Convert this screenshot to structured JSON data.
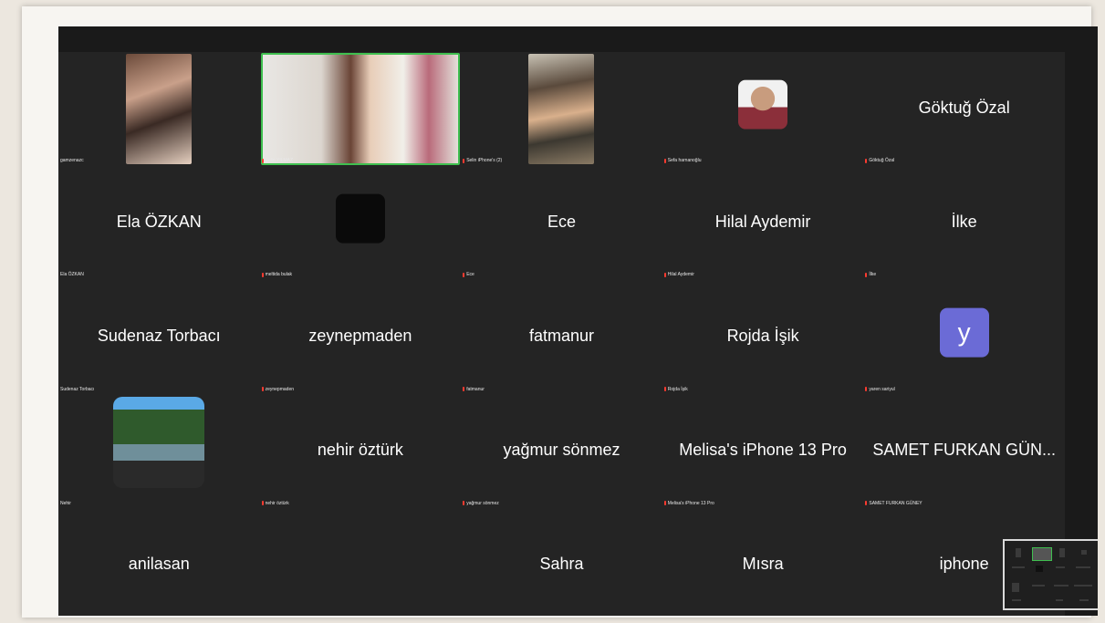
{
  "gallery": {
    "tiles": [
      {
        "name": "",
        "label": "gamzenazc",
        "kind": "video"
      },
      {
        "name": "",
        "label": "Selin YILMAZ",
        "kind": "video-active"
      },
      {
        "name": "",
        "label": "Selin iPhone's (2)",
        "kind": "video"
      },
      {
        "name": "",
        "label": "Sefa harnanoğlu",
        "kind": "avatar-photo"
      },
      {
        "name": "Göktuğ Özal",
        "label": "Göktuğ Özal",
        "kind": "name"
      },
      {
        "name": "Ela ÖZKAN",
        "label": "Ela ÖZKAN",
        "kind": "name"
      },
      {
        "name": "",
        "label": "meltida bulak",
        "kind": "avatar-dark"
      },
      {
        "name": "Ece",
        "label": "Ece",
        "kind": "name"
      },
      {
        "name": "Hilal Aydemir",
        "label": "Hilal Aydemir",
        "kind": "name"
      },
      {
        "name": "İlke",
        "label": "İlke",
        "kind": "name"
      },
      {
        "name": "Sudenaz Torbacı",
        "label": "Sudenaz Torbacı",
        "kind": "name"
      },
      {
        "name": "zeynepmaden",
        "label": "zeynepmaden",
        "kind": "name"
      },
      {
        "name": "fatmanur",
        "label": "fatmanur",
        "kind": "name"
      },
      {
        "name": "Rojda İşik",
        "label": "Rojda İşik",
        "kind": "name"
      },
      {
        "name": "",
        "label": "yaren sariyul",
        "kind": "avatar-letter",
        "letter": "y"
      },
      {
        "name": "",
        "label": "Nehir",
        "kind": "avatar-photo-lake"
      },
      {
        "name": "nehir öztürk",
        "label": "nehir öztürk",
        "kind": "name"
      },
      {
        "name": "yağmur sönmez",
        "label": "yağmur sönmez",
        "kind": "name"
      },
      {
        "name": "Melisa's iPhone 13 Pro",
        "label": "Melisa's iPhone 13 Pro",
        "kind": "name"
      },
      {
        "name": "SAMET FURKAN GÜN...",
        "label": "SAMET FURKAN GÜNEY",
        "kind": "name"
      },
      {
        "name": "anilasan",
        "label": "",
        "kind": "name"
      },
      {
        "name": "",
        "label": "",
        "kind": "empty"
      },
      {
        "name": "Sahra",
        "label": "",
        "kind": "name"
      },
      {
        "name": "Mısra",
        "label": "",
        "kind": "name"
      },
      {
        "name": "iphone",
        "label": "",
        "kind": "name"
      }
    ]
  },
  "colors": {
    "background": "#242424",
    "active_speaker_border": "#3fbf4f",
    "letter_avatar": "#6b6bd6",
    "muted_mic": "#ff3b30"
  },
  "icons": {
    "muted_mic": "mic-muted-icon"
  }
}
